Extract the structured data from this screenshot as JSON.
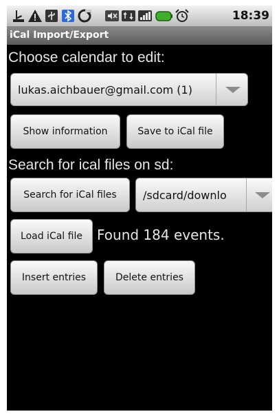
{
  "status_bar": {
    "time": "18:39",
    "icons": [
      "usb-debug-icon",
      "warning-icon",
      "usb-icon",
      "bluetooth-icon",
      "sync-icon",
      "mute-icon",
      "data-icon",
      "signal-icon",
      "battery-icon",
      "alarm-icon"
    ]
  },
  "title_bar": {
    "title": "iCal Import/Export"
  },
  "calendar_section": {
    "label": "Choose calendar to edit:",
    "selected_calendar": "lukas.aichbauer@gmail.com (1)",
    "show_info_button": "Show information",
    "save_button": "Save to iCal file"
  },
  "search_section": {
    "label": "Search for ical files on sd:",
    "search_button": "Search for iCal files",
    "selected_path": "/sdcard/downlo",
    "load_button": "Load iCal file",
    "found_text": "Found 184 events.",
    "insert_button": "Insert entries",
    "delete_button": "Delete entries"
  },
  "colors": {
    "screen_background": "#000000",
    "title_bar": "#6e6e6e",
    "text": "#e6e6e6",
    "button_face": "#e6e6e6"
  }
}
